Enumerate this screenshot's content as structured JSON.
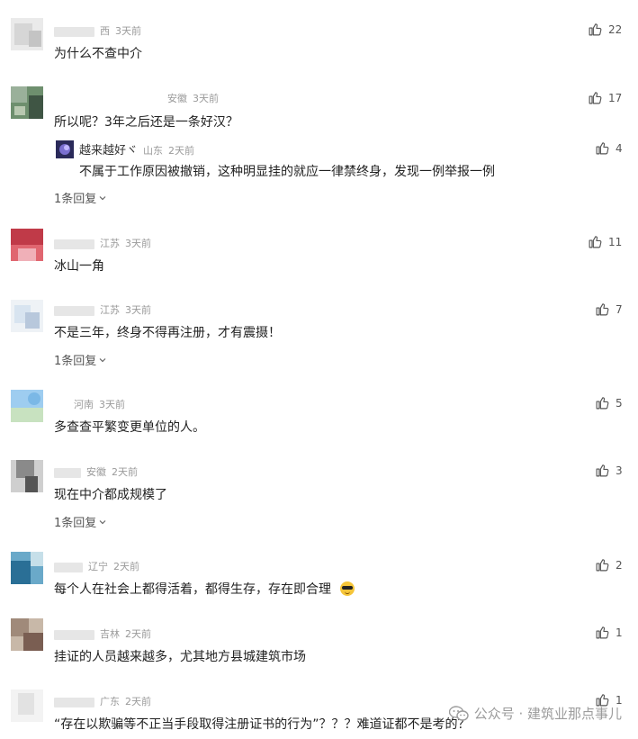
{
  "comments": [
    {
      "name": "",
      "location": "西",
      "time": "3天前",
      "text": "为什么不查中介",
      "likes": "22",
      "avatar_colors": [
        "#e8e8e8",
        "#d0d0d0",
        "#bdbdbd"
      ]
    },
    {
      "name": "",
      "location": "安徽",
      "time": "3天前",
      "text": "所以呢？3年之后还是一条好汉？",
      "likes": "17",
      "avatar_colors": [
        "#6e8f6e",
        "#9ab09a",
        "#445a47"
      ],
      "reply": {
        "name": "越来越好ヾ",
        "location": "山东",
        "time": "2天前",
        "text": "不属于工作原因被撤销，这种明显挂的就应一律禁终身，发现一例举报一例",
        "likes": "4",
        "avatar_colors": [
          "#2a2a5a",
          "#7a6fd0",
          "#c0b6ff"
        ]
      },
      "reply_count": "1条回复"
    },
    {
      "name": "",
      "location": "江苏",
      "time": "3天前",
      "text": "冰山一角",
      "likes": "11",
      "avatar_colors": [
        "#c03a48",
        "#e06670",
        "#f0b0b8"
      ]
    },
    {
      "name": "",
      "location": "江苏",
      "time": "3天前",
      "text": "不是三年，终身不得再注册，才有震摄！",
      "likes": "7",
      "avatar_colors": [
        "#d8e4f0",
        "#b8c8dc",
        "#eef2f6"
      ],
      "reply_count": "1条回复"
    },
    {
      "name": "",
      "location": "河南",
      "time": "3天前",
      "text": "多查查平繁变更单位的人。",
      "likes": "5",
      "avatar_colors": [
        "#9ecdf0",
        "#c8e2c0",
        "#7bb8e6"
      ]
    },
    {
      "name": "",
      "location": "安徽",
      "time": "2天前",
      "text": "现在中介都成规模了",
      "likes": "3",
      "avatar_colors": [
        "#8a8a8a",
        "#cfcfcf",
        "#555555"
      ],
      "reply_count": "1条回复"
    },
    {
      "name": "",
      "location": "辽宁",
      "time": "2天前",
      "text": "每个人在社会上都得活着，都得生存，存在即合理",
      "likes": "2",
      "avatar_colors": [
        "#2a6f96",
        "#6aa9c9",
        "#c6dfe9"
      ]
    },
    {
      "name": "",
      "location": "吉林",
      "time": "2天前",
      "text": "挂证的人员越来越多，尤其地方县城建筑市场",
      "likes": "1",
      "avatar_colors": [
        "#a08a7a",
        "#7a5e52",
        "#c8b8a8"
      ]
    },
    {
      "name": "",
      "location": "广东",
      "time": "2天前",
      "text": "“存在以欺骗等不正当手段取得注册证书的行为”？？？难道证都不是考的？",
      "likes": "1",
      "avatar_colors": [
        "#eeeeee",
        "#dddddd",
        "#cccccc"
      ]
    }
  ],
  "watermark": "公众号 · 建筑业那点事儿",
  "icons": {
    "like": "thumbs-up-icon",
    "chevron": "chevron-down-icon",
    "wechat": "wechat-icon"
  }
}
